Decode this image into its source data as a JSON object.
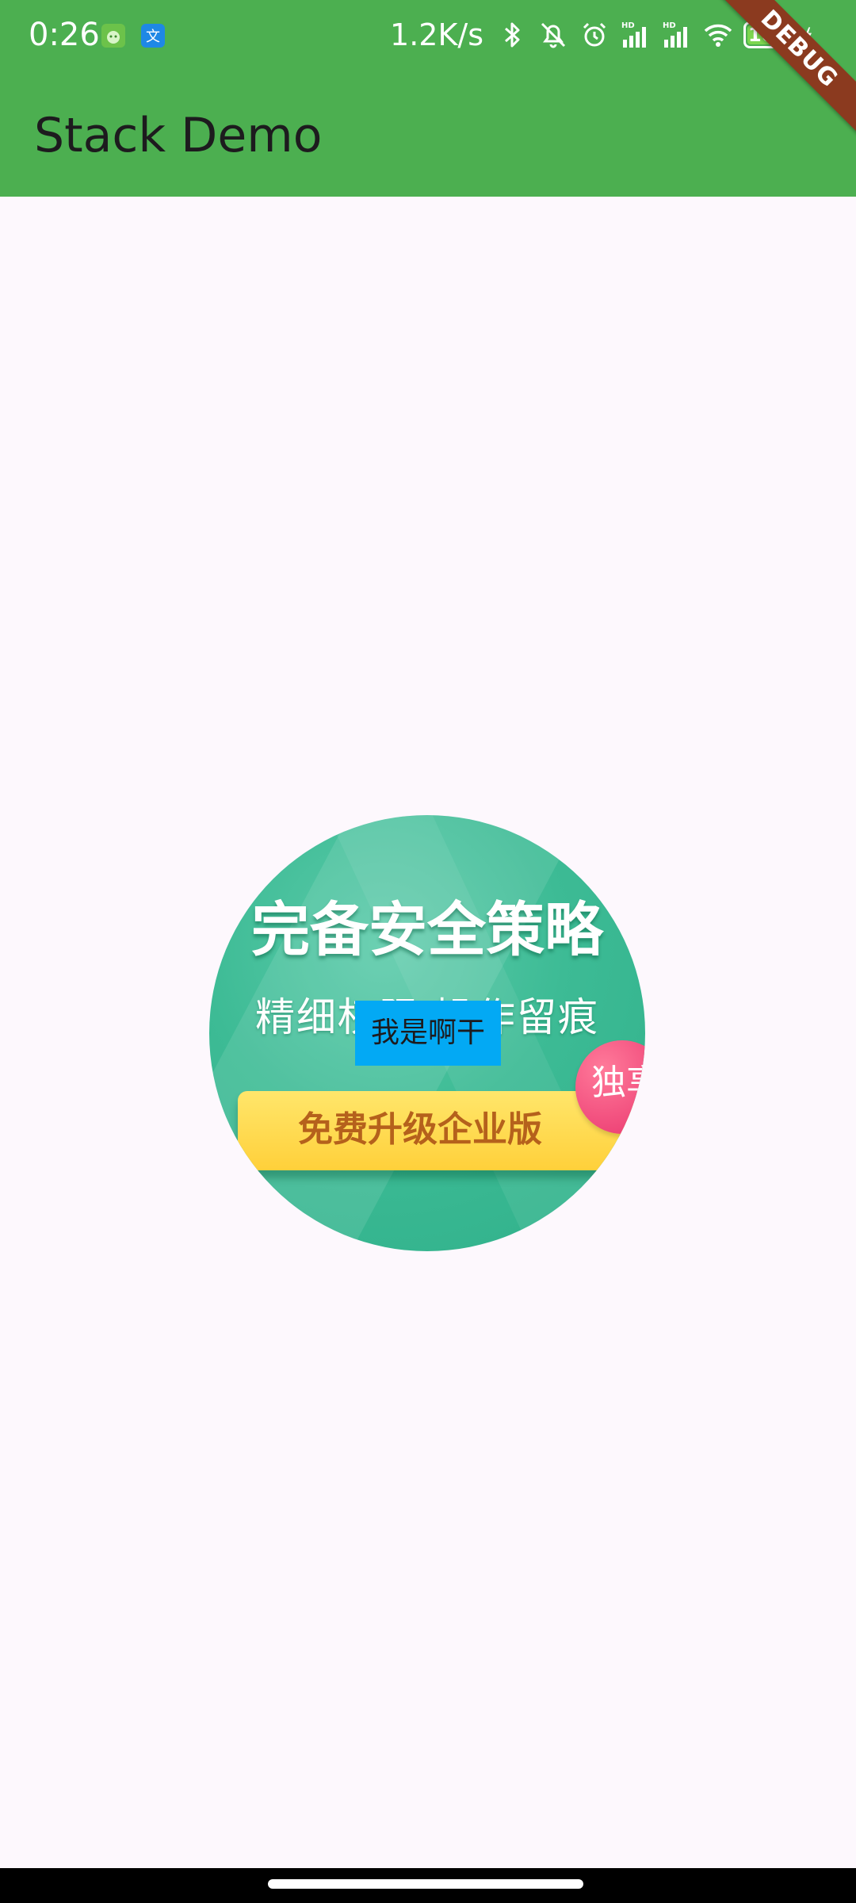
{
  "status_bar": {
    "time": "0:26",
    "net_speed": "1.2K/s",
    "battery_level": "100",
    "icons": [
      "android-icon",
      "translate-icon",
      "bluetooth-icon",
      "mute-icon",
      "alarm-icon",
      "signal-hd-icon",
      "signal-hd-icon",
      "wifi-icon",
      "battery-icon",
      "charging-icon"
    ]
  },
  "app_bar": {
    "title": "Stack Demo",
    "color": "#4caf50"
  },
  "debug_banner": {
    "label": "DEBUG"
  },
  "banner": {
    "headline": "完备安全策略",
    "subline": "精细权限 操作留痕",
    "cta": "免费升级企业版",
    "badge": "独享"
  },
  "overlay": {
    "label": "我是啊干",
    "color": "#03a9f4"
  }
}
